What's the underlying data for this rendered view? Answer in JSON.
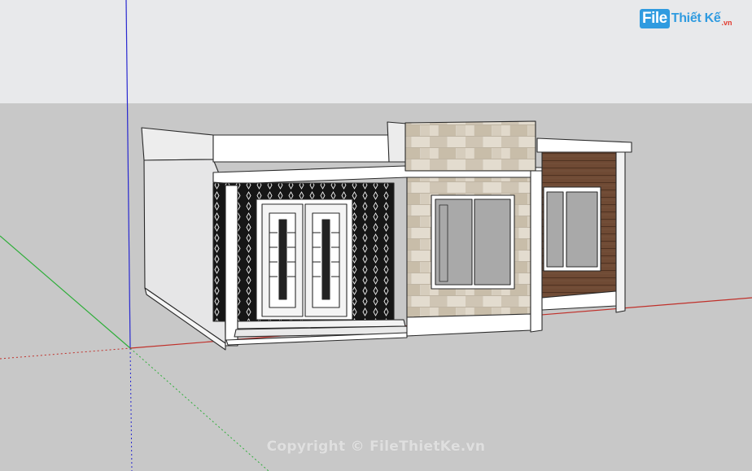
{
  "logo": {
    "file": "File",
    "brand": "Thiết Kế",
    "domain": ".vn"
  },
  "watermark": "Copyright © FileThietKe.vn",
  "colors": {
    "sky": "#e7e8ea",
    "ground": "#c8c8c8",
    "axis_red": "#c0302a",
    "axis_green": "#2fae3a",
    "axis_blue": "#2f2fd0",
    "wall_white": "#ffffff",
    "wall_side": "#e9e9ea",
    "stone": "#d8cfc0",
    "wood": "#6b4630",
    "decor_panel": "#141414",
    "glass": "#a6a6a6"
  }
}
